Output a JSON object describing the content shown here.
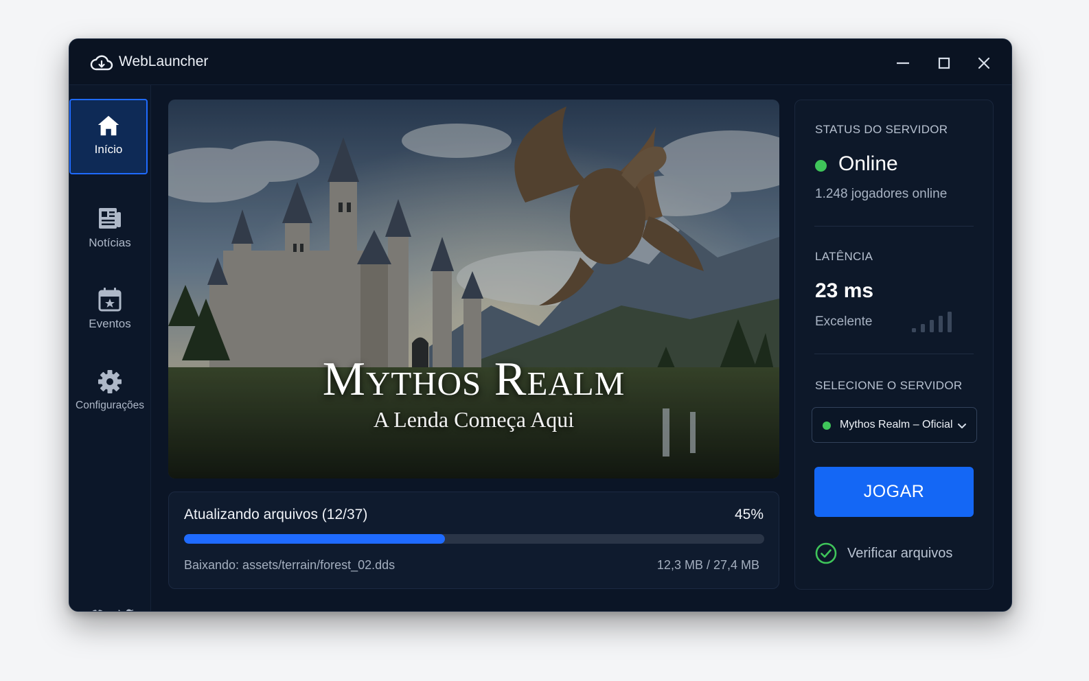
{
  "window": {
    "title": "WebLauncher",
    "icons": {
      "logo": "cloud-download-icon",
      "minimize": "minimize-icon",
      "maximize": "maximize-icon",
      "close": "close-icon"
    }
  },
  "sidebar": {
    "items": [
      {
        "label": "Início",
        "icon": "home-icon",
        "active": true
      },
      {
        "label": "Notícias",
        "icon": "newspaper-icon",
        "active": false
      },
      {
        "label": "Eventos",
        "icon": "calendar-star-icon",
        "active": false
      },
      {
        "label": "Configurações",
        "icon": "gear-icon",
        "active": false
      }
    ],
    "social": [
      "discord-icon",
      "twitter-icon"
    ]
  },
  "banner": {
    "title": "Mythos Realm",
    "subtitle": "A Lenda Começa Aqui"
  },
  "progress": {
    "title": "Atualizando arquivos (12/37)",
    "percent_label": "45%",
    "fraction": 0.45,
    "file": "Baixando: assets/terrain/forest_02.dds",
    "size": "12,3 MB / 27,4 MB"
  },
  "server": {
    "status_label": "STATUS DO SERVIDOR",
    "status": "Online",
    "players": "1.248 jogadores online",
    "latency_label": "LATÊNCIA",
    "latency": "23 ms",
    "latency_quality": "Excelente",
    "select_label": "SELECIONE O SERVIDOR",
    "selected_server": "Mythos Realm – Oficial",
    "play_label": "JOGAR",
    "verify_label": "Verificar arquivos"
  },
  "colors": {
    "accent": "#1f6bff",
    "online": "#3fc55a",
    "window_bg": "#0b1526"
  }
}
